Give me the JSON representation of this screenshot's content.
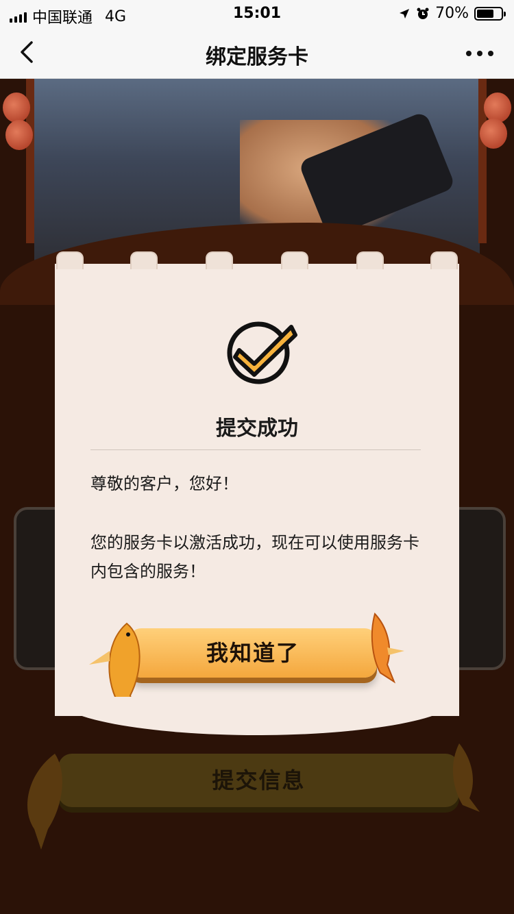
{
  "status_bar": {
    "carrier": "中国联通",
    "network": "4G",
    "time": "15:01",
    "battery": "70%",
    "battery_level": 0.7
  },
  "nav": {
    "title": "绑定服务卡",
    "back_icon": "chevron-left-icon",
    "more_icon": "more-horizontal-icon"
  },
  "dialog": {
    "icon": "check-circle-icon",
    "title": "提交成功",
    "greeting": "尊敬的客户，您好！",
    "message": "您的服务卡以激活成功，现在可以使用服务卡内包含的服务！",
    "confirm_label": "我知道了"
  },
  "background": {
    "submit_label": "提交信息"
  },
  "colors": {
    "accent": "#f4a73d",
    "check_fill": "#f6b23c",
    "dialog_bg": "#f5eae3",
    "page_bg": "#2b1207"
  }
}
